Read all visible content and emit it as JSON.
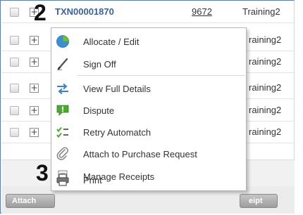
{
  "rows": [
    {
      "txn": "TXN00001870",
      "number": "9672",
      "category": "Training2"
    },
    {
      "category": "raining2"
    },
    {
      "category": "raining2"
    },
    {
      "category": "raining2"
    },
    {
      "category": "raining2"
    },
    {
      "category": "raining2"
    }
  ],
  "context_menu": {
    "items": [
      {
        "label": "Allocate / Edit",
        "icon": "pie-chart-icon"
      },
      {
        "label": "Sign Off",
        "icon": "pen-icon"
      },
      {
        "label": "View Full Details",
        "icon": "swap-arrows-icon"
      },
      {
        "label": "Dispute",
        "icon": "speech-bubble-alert-icon"
      },
      {
        "label": "Retry Automatch",
        "icon": "checklist-icon"
      },
      {
        "label": "Attach to Purchase Request",
        "icon": "paperclip-icon"
      },
      {
        "label": "Manage Receipts",
        "icon": "receipt-icon"
      },
      {
        "label": "Print",
        "icon": "printer-icon"
      }
    ]
  },
  "bottom_buttons": {
    "attach_label": "Attach",
    "receipt_label": "eipt"
  },
  "callouts": {
    "first": "2",
    "second": "3"
  },
  "colors": {
    "txn_link": "#3a5fa0",
    "frame_border": "#5b7fb5",
    "pie_blue": "#3b8fd8",
    "pie_green": "#6cbf3a",
    "arrow_blue": "#3a7fd0",
    "dispute_green": "#4aaa2e"
  }
}
